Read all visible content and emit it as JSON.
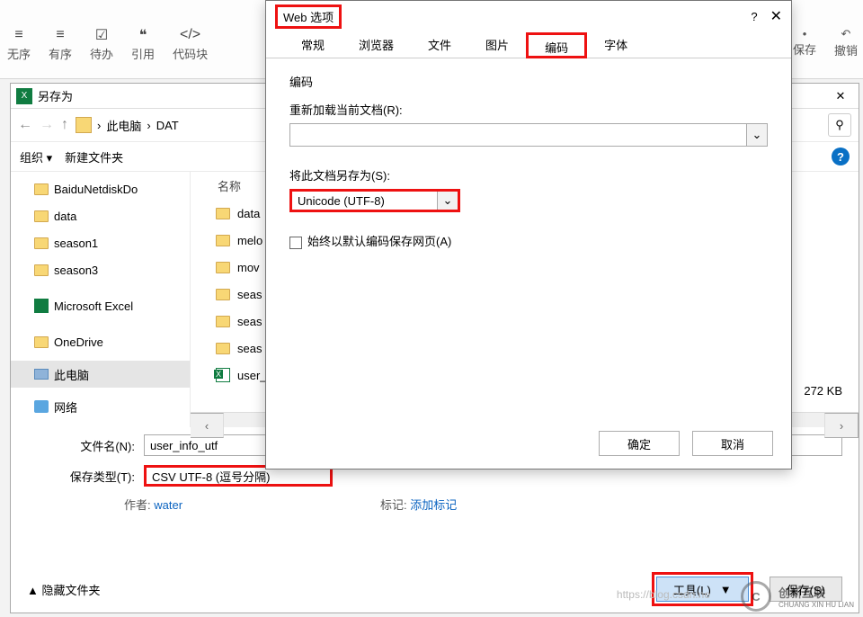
{
  "ribbon": {
    "items": [
      {
        "label": "无序",
        "glyph": "≡"
      },
      {
        "label": "有序",
        "glyph": "≡"
      },
      {
        "label": "待办",
        "glyph": "☑"
      },
      {
        "label": "引用",
        "glyph": "❝"
      },
      {
        "label": "代码块",
        "glyph": "</>"
      }
    ],
    "right": [
      {
        "label": "保存",
        "glyph": "▾"
      },
      {
        "label": "撤销",
        "glyph": "↶"
      }
    ]
  },
  "saveas": {
    "title": "另存为",
    "path_root": "此电脑",
    "path_sub": "DAT",
    "toolbar_organize": "组织",
    "toolbar_newfolder": "新建文件夹",
    "tree": [
      {
        "label": "BaiduNetdiskDo",
        "type": "folder"
      },
      {
        "label": "data",
        "type": "folder"
      },
      {
        "label": "season1",
        "type": "folder"
      },
      {
        "label": "season3",
        "type": "folder"
      },
      {
        "label": "Microsoft Excel",
        "type": "excel"
      },
      {
        "label": "OneDrive",
        "type": "folder"
      },
      {
        "label": "此电脑",
        "type": "pc",
        "selected": true
      },
      {
        "label": "网络",
        "type": "net"
      }
    ],
    "col_name": "名称",
    "files": [
      {
        "label": "data",
        "type": "folder"
      },
      {
        "label": "melo",
        "type": "folder"
      },
      {
        "label": "mov",
        "type": "folder"
      },
      {
        "label": "seas",
        "type": "folder"
      },
      {
        "label": "seas",
        "type": "folder"
      },
      {
        "label": "seas",
        "type": "folder"
      },
      {
        "label": "user_",
        "type": "xlsx"
      }
    ],
    "size_value": "272 KB",
    "filename_label": "文件名(N):",
    "filename_value": "user_info_utf",
    "filetype_label": "保存类型(T):",
    "filetype_value": "CSV UTF-8 (逗号分隔)",
    "author_label": "作者:",
    "author_value": "water",
    "tag_label": "标记:",
    "tag_value": "添加标记",
    "hide_folders": "隐藏文件夹",
    "tools_btn": "工具(L)",
    "save_btn": "保存(S)"
  },
  "web": {
    "title": "Web 选项",
    "tabs": [
      "常规",
      "浏览器",
      "文件",
      "图片",
      "编码",
      "字体"
    ],
    "active_tab_index": 4,
    "section_encoding": "编码",
    "reload_label": "重新加载当前文档(R):",
    "saveas_label": "将此文档另存为(S):",
    "saveas_value": "Unicode (UTF-8)",
    "always_save_label": "始终以默认编码保存网页(A)",
    "ok": "确定",
    "cancel": "取消"
  },
  "watermark": {
    "brand": "创新互联",
    "sub": "CHUANG XIN HU LIAN",
    "url": "https://blog.csdn.ne"
  }
}
